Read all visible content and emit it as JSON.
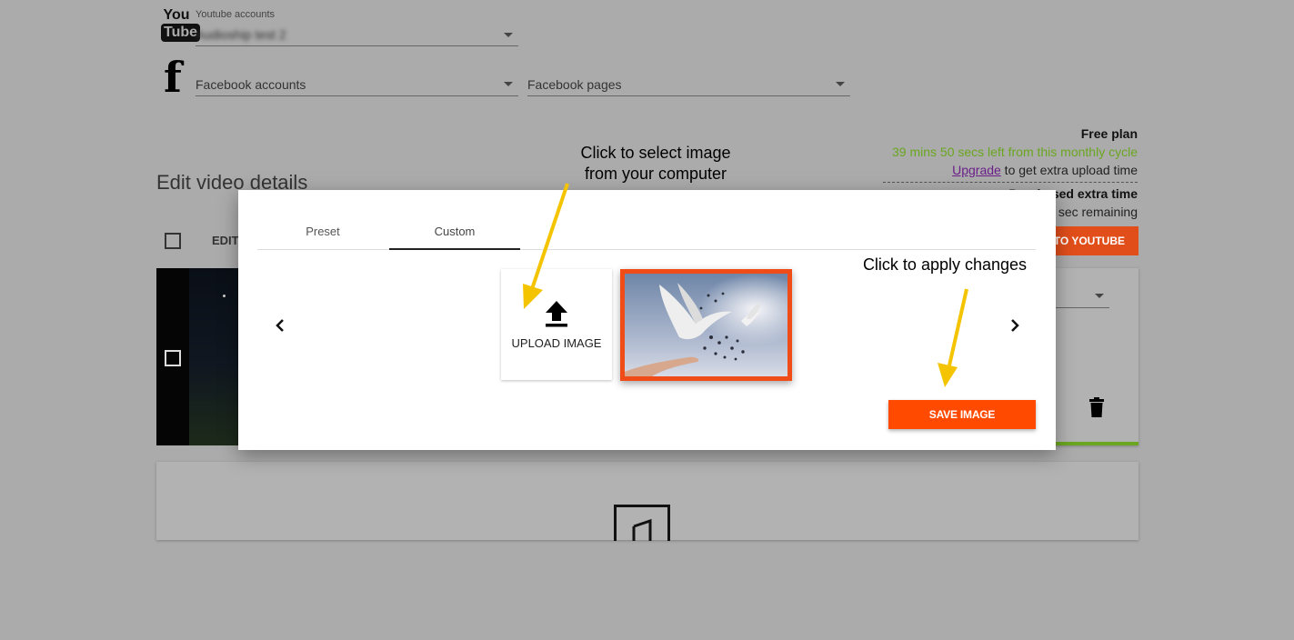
{
  "accounts": {
    "youtube_label": "Youtube accounts",
    "youtube_value": "Audioship test 2",
    "youtube_logo_you": "You",
    "youtube_logo_tube": "Tube",
    "facebook_logo": "f",
    "facebook_accounts_placeholder": "Facebook accounts",
    "facebook_pages_placeholder": "Facebook pages"
  },
  "plan": {
    "title": "Free plan",
    "time_left": "39 mins 50 secs left from this monthly cycle",
    "upgrade_link": "Upgrade",
    "upgrade_suffix": " to get extra upload time",
    "extra_title": "Purchased extra time",
    "extra_remaining": "sec remaining"
  },
  "edit": {
    "heading": "Edit video details",
    "edit_label": "EDIT",
    "upload_button": "TO YOUTUBE"
  },
  "modal": {
    "tabs": [
      {
        "label": "Preset",
        "active": false
      },
      {
        "label": "Custom",
        "active": true
      }
    ],
    "upload_label": "UPLOAD IMAGE",
    "save_label": "SAVE IMAGE"
  },
  "annotations": {
    "select_image_line1": "Click to select image",
    "select_image_line2": "from your computer",
    "apply_changes": "Click to apply changes"
  },
  "colors": {
    "overlay_background": "#ababab",
    "accent_orange": "#ff4a00",
    "plan_green": "#6aa620",
    "arrow_yellow": "#f5c400"
  }
}
